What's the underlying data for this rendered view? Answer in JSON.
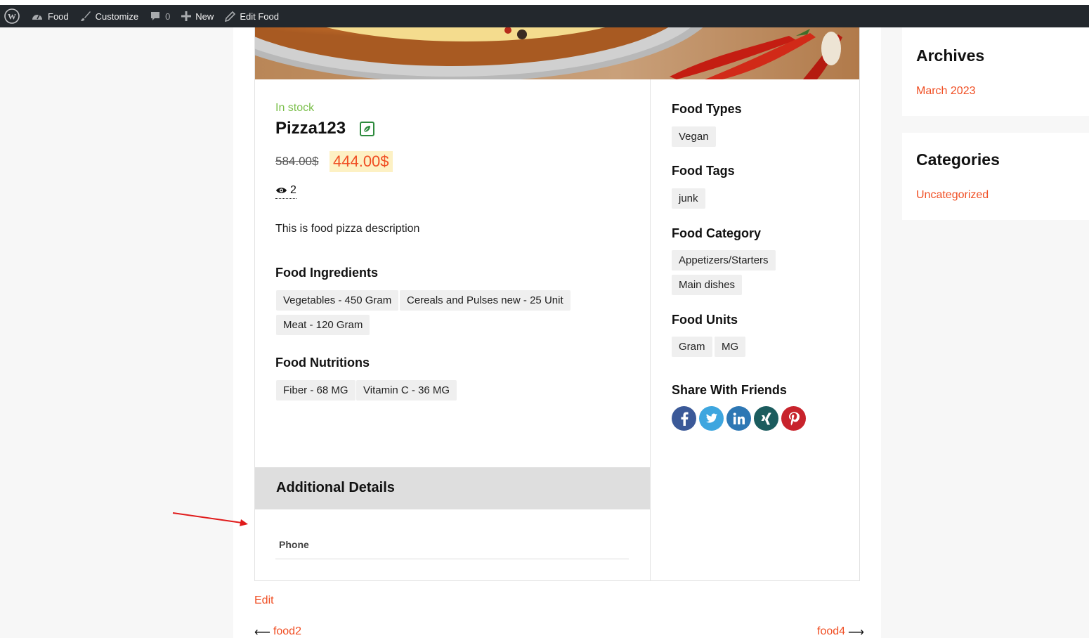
{
  "adminbar": {
    "site": "Food",
    "customize": "Customize",
    "comments_count": "0",
    "new": "New",
    "edit": "Edit Food"
  },
  "product": {
    "stock": "In stock",
    "title": "Pizza123",
    "old_price": "584.00$",
    "new_price": "444.00$",
    "views": "2",
    "description": "This is food pizza description"
  },
  "ingredients": {
    "heading": "Food Ingredients",
    "items": [
      "Vegetables - 450 Gram",
      "Cereals and Pulses new - 25 Unit",
      "Meat - 120 Gram"
    ]
  },
  "nutritions": {
    "heading": "Food Nutritions",
    "items": [
      "Fiber - 68 MG",
      "Vitamin C - 36 MG"
    ]
  },
  "additional": {
    "heading": "Additional Details",
    "phone_label": "Phone"
  },
  "side": {
    "types_heading": "Food Types",
    "types": [
      "Vegan"
    ],
    "tags_heading": "Food Tags",
    "tags": [
      "junk"
    ],
    "category_heading": "Food Category",
    "categories": [
      "Appetizers/Starters",
      "Main dishes"
    ],
    "units_heading": "Food Units",
    "units": [
      "Gram",
      "MG"
    ],
    "share_heading": "Share With Friends",
    "share_icons": [
      "facebook-icon",
      "twitter-icon",
      "linkedin-icon",
      "xing-icon",
      "pinterest-icon"
    ]
  },
  "footer": {
    "edit": "Edit",
    "prev": "food2",
    "next": "food4"
  },
  "widgets": {
    "archives_title": "Archives",
    "archives_link": "March 2023",
    "categories_title": "Categories",
    "categories_link": "Uncategorized"
  },
  "colors": {
    "accent": "#f04e23",
    "stock": "#7bbf4b",
    "adminbar": "#23282d"
  }
}
